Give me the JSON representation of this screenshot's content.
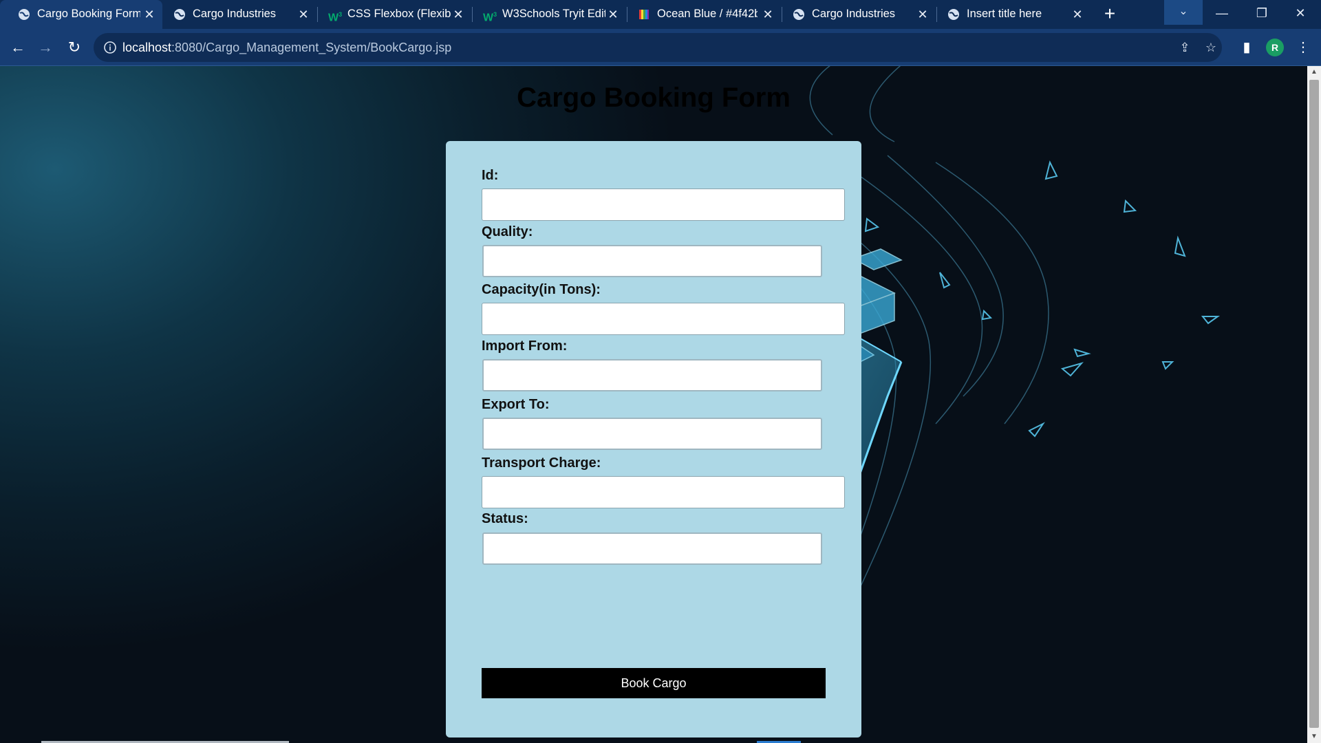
{
  "browser": {
    "tabs": [
      {
        "title": "Cargo Booking Form",
        "icon": "globe-icon",
        "active": true
      },
      {
        "title": "Cargo Industries",
        "icon": "globe-icon",
        "active": false
      },
      {
        "title": "CSS Flexbox (Flexible",
        "icon": "w3schools-icon",
        "active": false
      },
      {
        "title": "W3Schools Tryit Edito",
        "icon": "w3schools-icon",
        "active": false
      },
      {
        "title": "Ocean Blue / #4f42b5",
        "icon": "color-palette-icon",
        "active": false
      },
      {
        "title": "Cargo Industries",
        "icon": "globe-icon",
        "active": false
      },
      {
        "title": "Insert title here",
        "icon": "globe-icon",
        "active": false
      }
    ],
    "url_host": "localhost",
    "url_path": ":8080/Cargo_Management_System/BookCargo.jsp",
    "profile_initial": "R",
    "colors": {
      "tabstrip": "#0d2b55",
      "toolbar": "#173d73",
      "avatar": "#1a9e63"
    }
  },
  "page": {
    "title": "Cargo Booking Form",
    "form": {
      "fields": [
        {
          "label": "Id:",
          "value": ""
        },
        {
          "label": "Quality:",
          "value": ""
        },
        {
          "label": "Capacity(in Tons):",
          "value": ""
        },
        {
          "label": "Import From:",
          "value": ""
        },
        {
          "label": "Export To:",
          "value": ""
        },
        {
          "label": "Transport Charge:",
          "value": ""
        },
        {
          "label": "Status:",
          "value": ""
        }
      ],
      "submit_label": "Book Cargo"
    },
    "colors": {
      "card": "#add8e6",
      "button": "#000000",
      "button_text": "#ffffff"
    }
  }
}
